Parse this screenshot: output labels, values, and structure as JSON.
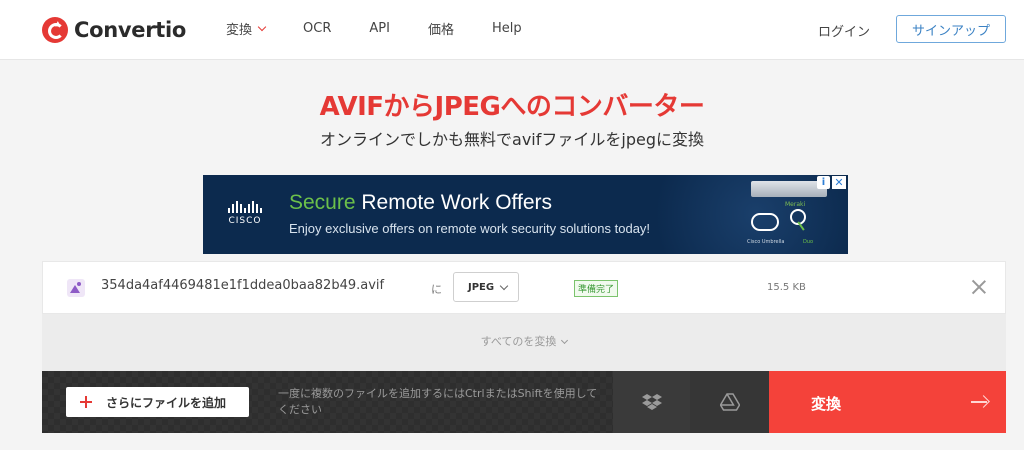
{
  "header": {
    "logo_text": "Convertio",
    "nav": [
      {
        "label": "変換",
        "dropdown": true
      },
      {
        "label": "OCR"
      },
      {
        "label": "API"
      },
      {
        "label": "価格"
      },
      {
        "label": "Help"
      }
    ],
    "login": "ログイン",
    "signup": "サインアップ"
  },
  "page": {
    "title": "AVIFからJPEGへのコンバーター",
    "subtitle": "オンラインでしかも無料でavifファイルをjpegに変換"
  },
  "ad": {
    "brand": "CISCO",
    "headline_accent": "Secure",
    "headline_rest": " Remote Work Offers",
    "subline": "Enjoy exclusive offers on remote work security solutions today!",
    "device_label": "Meraki",
    "caption_left": "Cisco Umbrella",
    "caption_right": "Duo",
    "info_glyph": "i",
    "close_glyph": "✕",
    "accent_color": "#6cc04a",
    "background_color": "#0c2a4e"
  },
  "file": {
    "name": "354da4af4469481e1f1ddea0baa82b49.avif",
    "to_label": "に",
    "format": "JPEG",
    "status": "準備完了",
    "size": "15.5 KB"
  },
  "convert_all": "すべてのを変換",
  "bottom_bar": {
    "add_files": "さらにファイルを追加",
    "hint": "一度に複数のファイルを追加するにはCtrlまたはShiftを使用してください",
    "convert": "変換"
  },
  "colors": {
    "brand_red": "#e53935",
    "convert_button": "#f4423a",
    "signup_border": "#6fa8dc",
    "status_green": "#3c9a37"
  },
  "icons": [
    "convertio-logo-icon",
    "chevron-down-icon",
    "image-file-icon",
    "close-icon",
    "plus-icon",
    "dropbox-icon",
    "google-drive-icon",
    "arrow-right-icon"
  ]
}
